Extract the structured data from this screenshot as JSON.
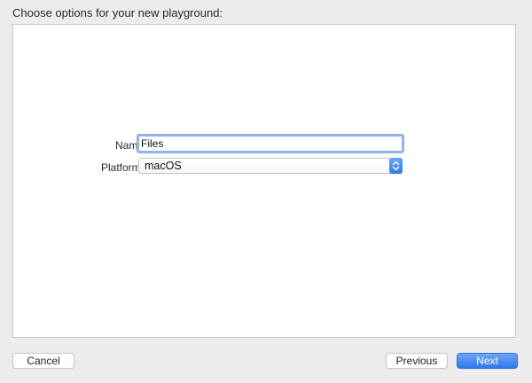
{
  "dialog": {
    "header": "Choose options for your new playground:"
  },
  "form": {
    "name_label": "Name",
    "name_value": "Files",
    "platform_label": "Platform:",
    "platform_value": "macOS"
  },
  "buttons": {
    "cancel": "Cancel",
    "previous": "Previous",
    "next": "Next"
  },
  "colors": {
    "accent": "#3b82f0",
    "focus_ring": "#8fb4e6",
    "window_bg": "#ececec"
  },
  "icons": {
    "platform_stepper": "chevron-up-down-icon"
  }
}
